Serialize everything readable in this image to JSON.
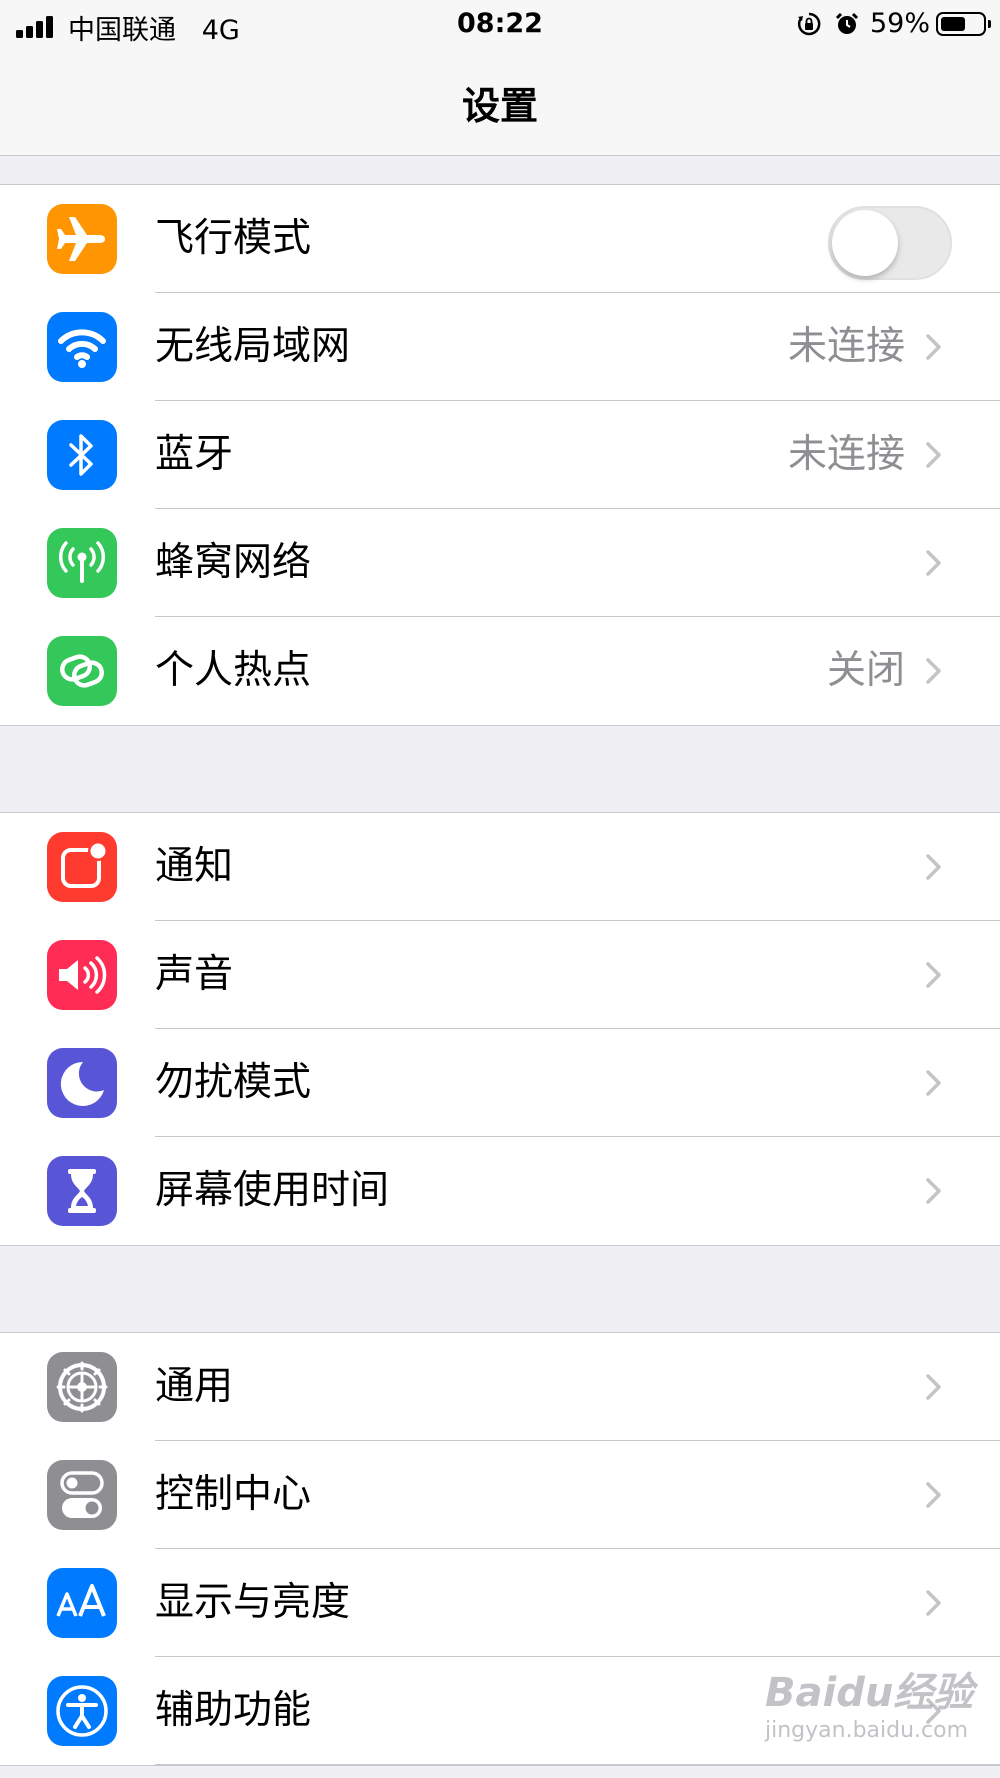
{
  "status_bar": {
    "carrier": "中国联通",
    "network": "4G",
    "time": "08:22",
    "battery_percent": "59%",
    "battery_level": 0.59
  },
  "header": {
    "title": "设置"
  },
  "groups": [
    {
      "rows": [
        {
          "label": "飞行模式",
          "icon": "airplane-icon",
          "icon_bg": "#ff9500",
          "toggle_on": false
        },
        {
          "label": "无线局域网",
          "value": "未连接",
          "icon": "wifi-icon",
          "icon_bg": "#007aff"
        },
        {
          "label": "蓝牙",
          "value": "未连接",
          "icon": "bluetooth-icon",
          "icon_bg": "#007aff"
        },
        {
          "label": "蜂窝网络",
          "icon": "cellular-antenna-icon",
          "icon_bg": "#34c759"
        },
        {
          "label": "个人热点",
          "value": "关闭",
          "icon": "hotspot-chain-icon",
          "icon_bg": "#34c759"
        }
      ]
    },
    {
      "rows": [
        {
          "label": "通知",
          "icon": "notification-badge-icon",
          "icon_bg": "#ff3b30"
        },
        {
          "label": "声音",
          "icon": "speaker-icon",
          "icon_bg": "#ff2d55"
        },
        {
          "label": "勿扰模式",
          "icon": "moon-icon",
          "icon_bg": "#5856d6"
        },
        {
          "label": "屏幕使用时间",
          "icon": "hourglass-icon",
          "icon_bg": "#5856d6"
        }
      ]
    },
    {
      "rows": [
        {
          "label": "通用",
          "icon": "gear-icon",
          "icon_bg": "#8e8e93"
        },
        {
          "label": "控制中心",
          "icon": "toggles-icon",
          "icon_bg": "#8e8e93"
        },
        {
          "label": "显示与亮度",
          "icon": "text-size-icon",
          "icon_bg": "#007aff"
        },
        {
          "label": "辅助功能",
          "icon": "accessibility-icon",
          "icon_bg": "#007aff"
        }
      ]
    }
  ],
  "watermark": {
    "line1": "Baidu经验",
    "line2": "jingyan.baidu.com"
  }
}
